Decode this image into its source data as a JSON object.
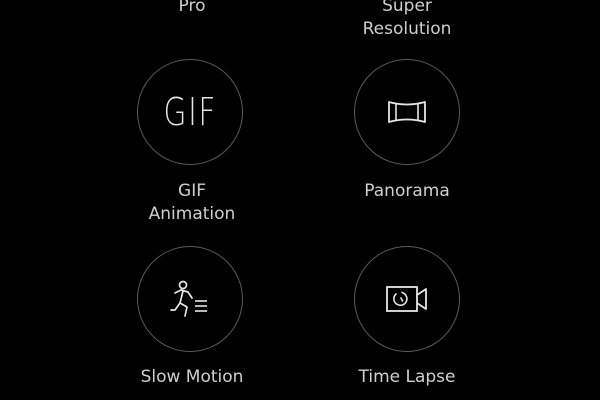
{
  "modes": [
    {
      "id": "pro",
      "label": "Pro",
      "icon": ""
    },
    {
      "id": "super-resolution",
      "label": "Super\nResolution",
      "icon": ""
    },
    {
      "id": "gif-animation",
      "label": "GIF\nAnimation",
      "icon": "gif-text-icon",
      "icon_text": "GIF"
    },
    {
      "id": "panorama",
      "label": "Panorama",
      "icon": "panorama-icon"
    },
    {
      "id": "slow-motion",
      "label": "Slow Motion",
      "icon": "running-person-icon"
    },
    {
      "id": "time-lapse",
      "label": "Time Lapse",
      "icon": "timelapse-camera-icon"
    }
  ],
  "colors": {
    "background": "#000000",
    "label": "#cfcfcf",
    "circle_border": "#5a5a5a",
    "icon": "#e6e6e6"
  }
}
